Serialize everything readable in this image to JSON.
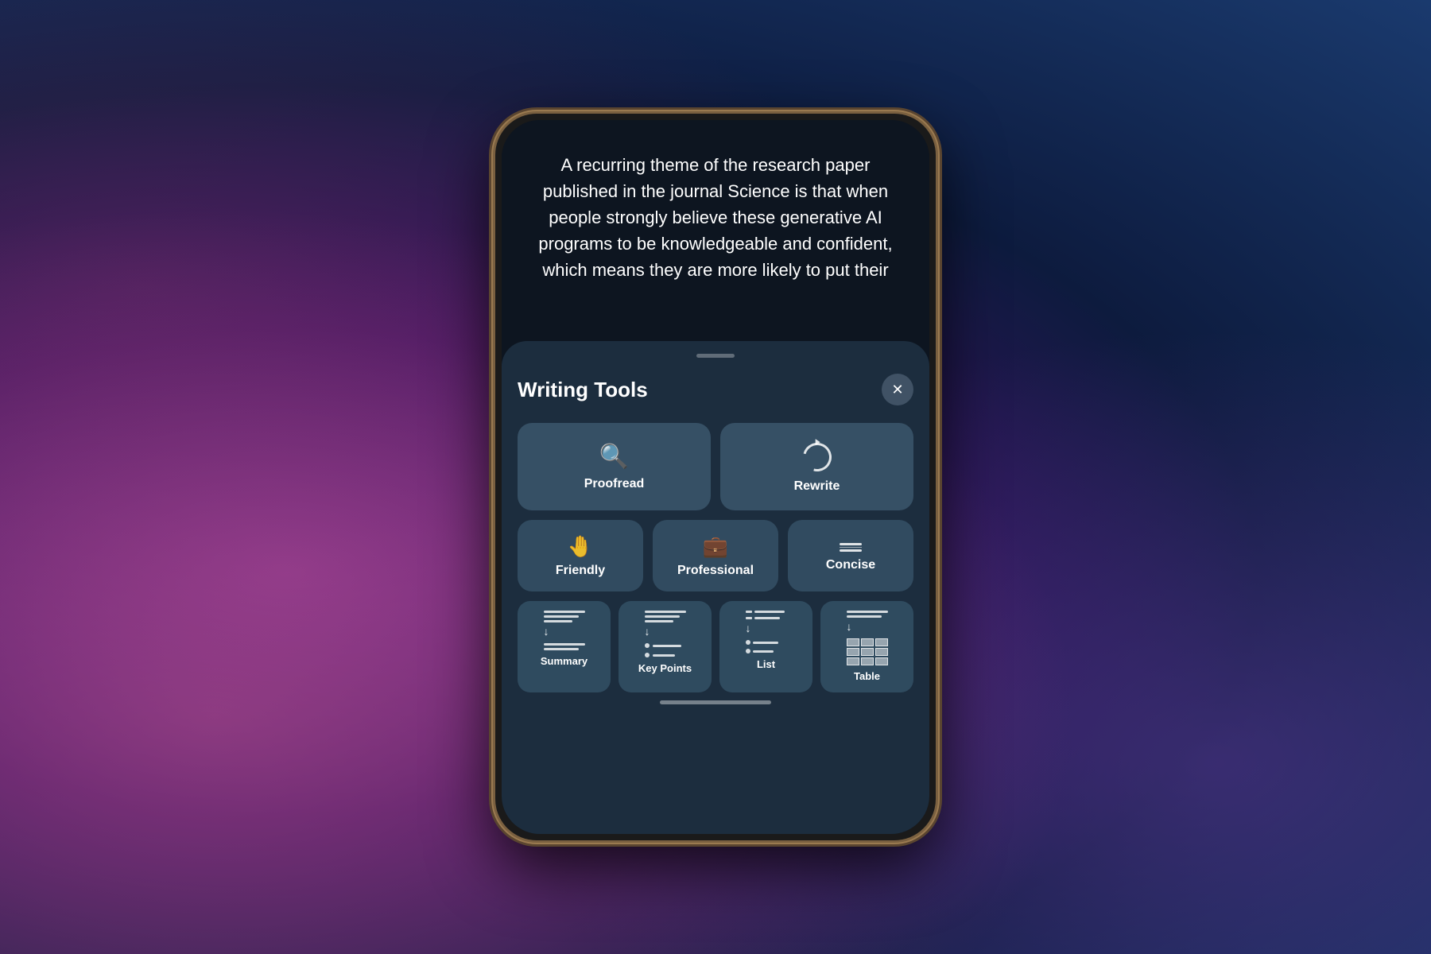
{
  "background": {
    "colors": [
      "#7b2d8b",
      "#0d1b3e",
      "#1a3a6e"
    ]
  },
  "article": {
    "text": "A recurring theme of the research paper published in the journal Science is that when people strongly believe these generative AI programs to be knowledgeable and confident, which means they are more likely to put their"
  },
  "sheet": {
    "handle_label": "",
    "title": "Writing Tools",
    "close_label": "✕"
  },
  "tools": {
    "proofread": {
      "label": "Proofread",
      "icon": "🔍"
    },
    "rewrite": {
      "label": "Rewrite",
      "icon": "rewrite"
    },
    "friendly": {
      "label": "Friendly",
      "icon": "👋"
    },
    "professional": {
      "label": "Professional",
      "icon": "💼"
    },
    "concise": {
      "label": "Concise",
      "icon": "concise"
    },
    "summary": {
      "label": "Summary",
      "icon": "summary"
    },
    "key_points": {
      "label": "Key Points",
      "icon": "key_points"
    },
    "list": {
      "label": "List",
      "icon": "list"
    },
    "table": {
      "label": "Table",
      "icon": "table"
    }
  },
  "home_indicator": ""
}
